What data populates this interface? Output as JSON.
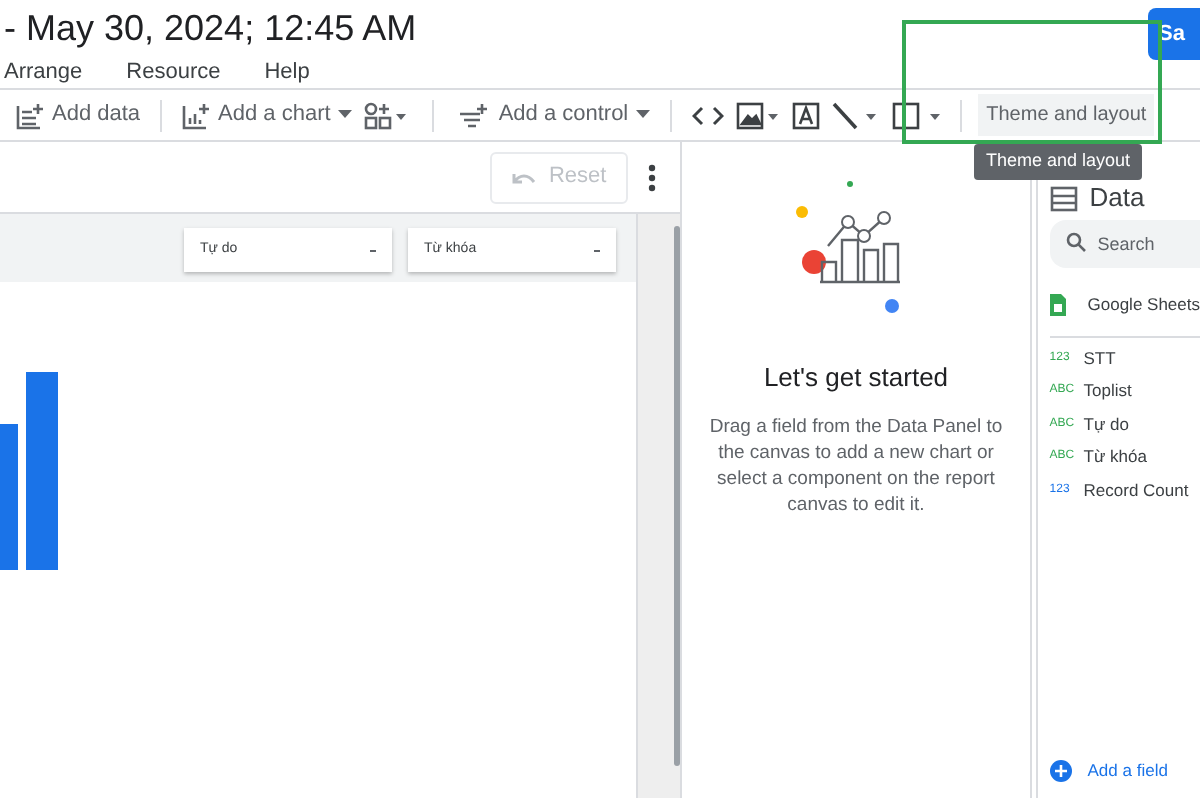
{
  "title": "- May 30, 2024; 12:45 AM",
  "menu": [
    "Arrange",
    "Resource",
    "Help"
  ],
  "save_button": "Sa",
  "toolbar": {
    "add_data": "Add data",
    "add_chart": "Add a chart",
    "add_control": "Add a control",
    "theme_button": "Theme and layout",
    "tooltip": "Theme and layout"
  },
  "reset_button": {
    "label": "Reset",
    "disabled": true
  },
  "filters": [
    {
      "label": "Tự do"
    },
    {
      "label": "Từ khóa"
    }
  ],
  "properties_panel": {
    "heading": "Let's get started",
    "text": "Drag a field from the Data Panel to the canvas to add a new chart or select a component on the report canvas to edit it."
  },
  "data_panel": {
    "heading": "Data",
    "search_placeholder": "Search",
    "source": "Google Sheets",
    "fields": [
      {
        "type_label": "123",
        "name": "STT",
        "color": "#34a853"
      },
      {
        "type_label": "ABC",
        "name": "Toplist",
        "color": "#34a853"
      },
      {
        "type_label": "ABC",
        "name": "Tự do",
        "color": "#34a853"
      },
      {
        "type_label": "ABC",
        "name": "Từ khóa",
        "color": "#34a853"
      },
      {
        "type_label": "123",
        "name": "Record Count",
        "color": "#1a73e8"
      }
    ],
    "add_field": "Add a field"
  }
}
